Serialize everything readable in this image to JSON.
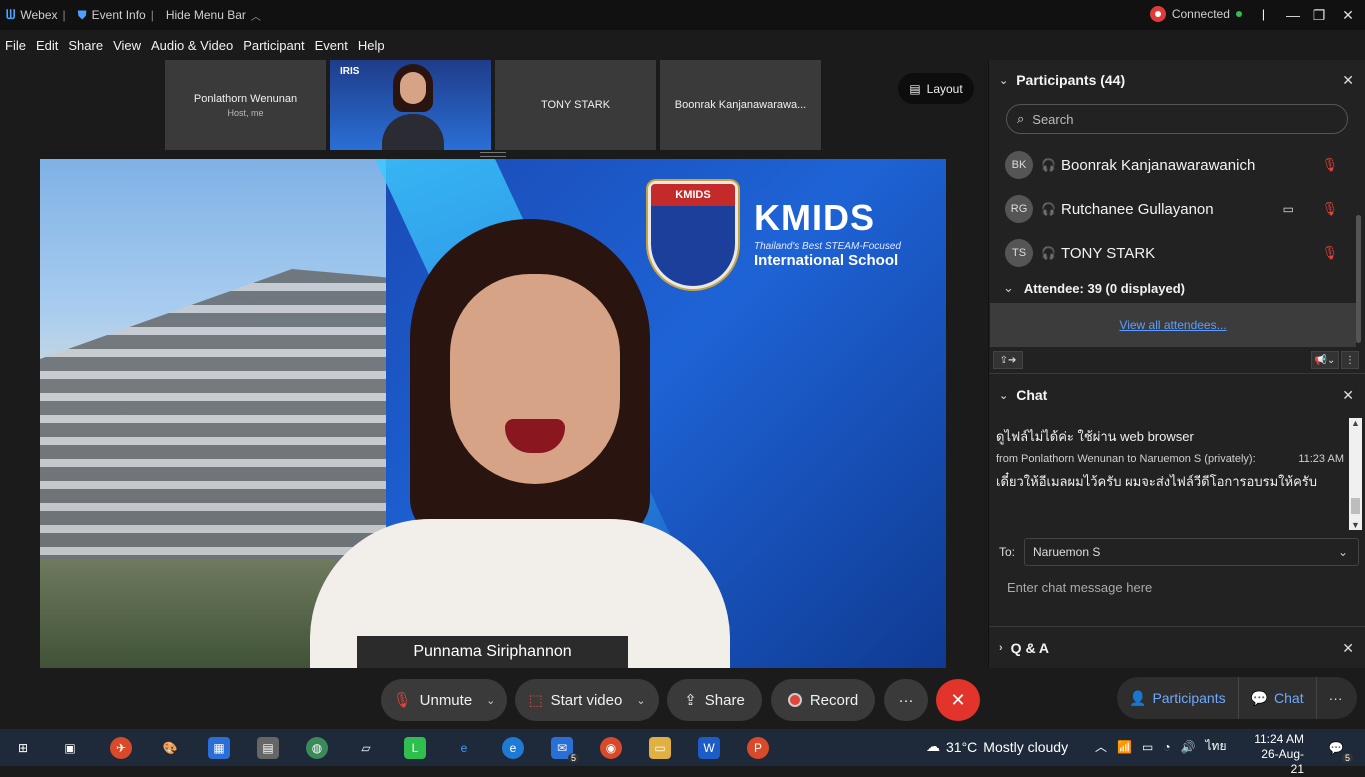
{
  "titlebar": {
    "app_name": "Webex",
    "event_info": "Event Info",
    "hide_menu_bar": "Hide Menu Bar",
    "connection_status": "Connected",
    "minimize": "—",
    "restore": "❐",
    "close": "✕",
    "divider": "|"
  },
  "menubar": {
    "items": [
      "File",
      "Edit",
      "Share",
      "View",
      "Audio & Video",
      "Participant",
      "Event",
      "Help"
    ]
  },
  "thumbnails": [
    {
      "name": "Ponlathorn Wenunan",
      "sub": "Host, me"
    },
    {
      "name": "TONY STARK"
    },
    {
      "name": "Boonrak Kanjanawarawa..."
    }
  ],
  "self_thumb_brand": "IRIS",
  "layout_button": "Layout",
  "main_video": {
    "speaker_name": "Punnama Siriphannon",
    "logo_big": "KMIDS",
    "logo_tagline": "Thailand's Best STEAM-Focused",
    "logo_sub": "International School",
    "shield_text": "KMIDS"
  },
  "controls": {
    "unmute": "Unmute",
    "start_video": "Start video",
    "share": "Share",
    "record": "Record",
    "more": "···",
    "leave": "✕",
    "participants_toggle": "Participants",
    "chat_toggle": "Chat",
    "panel_more": "···",
    "chevron": "⌄"
  },
  "participants_panel": {
    "title": "Participants (44)",
    "search_placeholder": "Search",
    "people": [
      {
        "initials": "BK",
        "name": "Boonrak Kanjanawarawanich",
        "has_video_icon": false
      },
      {
        "initials": "RG",
        "name": "Rutchanee Gullayanon",
        "has_video_icon": true
      },
      {
        "initials": "TS",
        "name": "TONY STARK",
        "has_video_icon": false
      }
    ],
    "attendee_header": "Attendee: 39 (0 displayed)",
    "view_all": "View all attendees..."
  },
  "chat_panel": {
    "title": "Chat",
    "messages": [
      {
        "text": "ดูไฟล์ไม่ได้ค่ะ ใช้ผ่าน web browser"
      },
      {
        "from": "from Ponlathorn Wenunan to Naruemon S (privately):",
        "time": "11:23 AM",
        "text": "เดี๋ยวให้อีเมลผมไว้ครับ ผมจะส่งไฟล์วีดีโอการอบรมให้ครับ"
      }
    ],
    "to_label": "To:",
    "to_value": "Naruemon S",
    "input_placeholder": "Enter chat message here"
  },
  "qa_panel": {
    "title": "Q & A"
  },
  "taskbar": {
    "weather_temp": "31°C",
    "weather_desc": "Mostly cloudy",
    "lang": "ไทย",
    "time": "11:24 AM",
    "date": "26-Aug-21",
    "mail_badge": "5",
    "notif_badge": "5"
  },
  "colors": {
    "accent_blue": "#5c9dff",
    "leave_red": "#e2342a",
    "mute_red": "#e0443a",
    "connected_green": "#2fbf4f"
  }
}
